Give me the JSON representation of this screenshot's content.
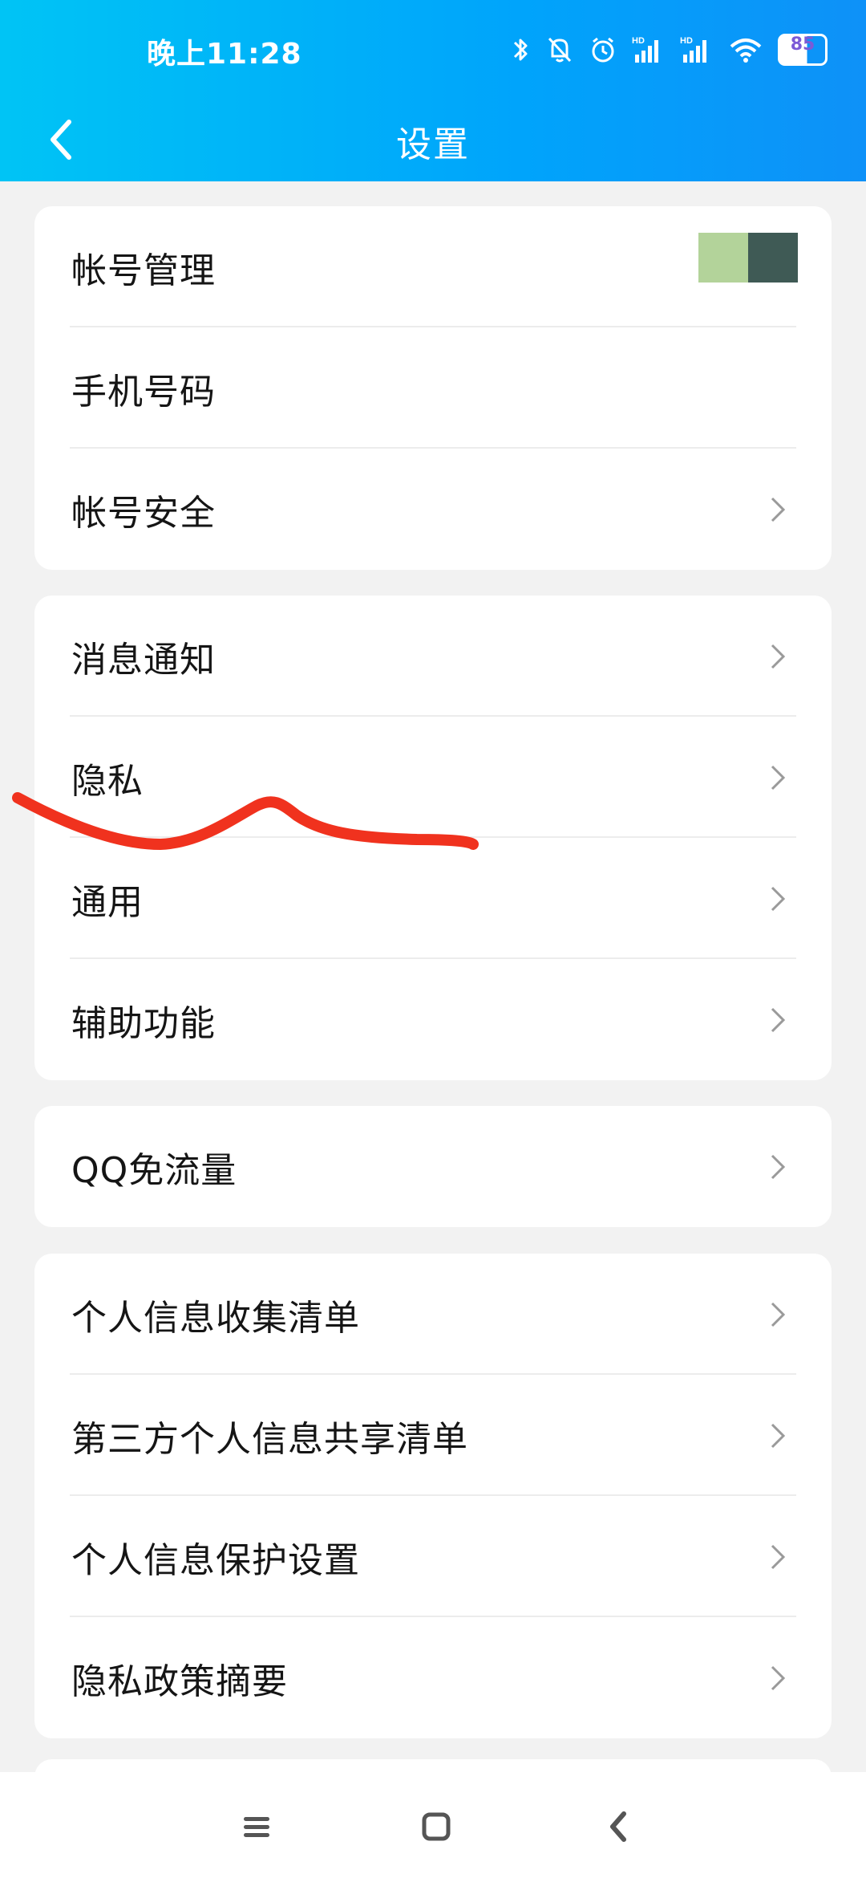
{
  "status_bar": {
    "time": "晚上11:28",
    "icons": [
      "bluetooth-icon",
      "mute-icon",
      "alarm-icon",
      "hd-signal-icon",
      "hd-signal-icon",
      "wifi-icon",
      "battery-icon"
    ],
    "battery_level": "85"
  },
  "header": {
    "title": "设置",
    "back_icon": "chevron-left-icon",
    "background_colors": [
      "#00c4f5",
      "#00a4fb",
      "#0e91f8"
    ]
  },
  "groups": [
    {
      "items": [
        {
          "label": "帐号管理",
          "trailing": "avatar"
        },
        {
          "label": "手机号码",
          "trailing": "none"
        },
        {
          "label": "帐号安全",
          "trailing": "chevron-right-icon"
        }
      ]
    },
    {
      "items": [
        {
          "label": "消息通知",
          "trailing": "chevron-right-icon"
        },
        {
          "label": "隐私",
          "trailing": "chevron-right-icon"
        },
        {
          "label": "通用",
          "trailing": "chevron-right-icon"
        },
        {
          "label": "辅助功能",
          "trailing": "chevron-right-icon"
        }
      ]
    },
    {
      "items": [
        {
          "label": "QQ免流量",
          "trailing": "chevron-right-icon"
        }
      ]
    },
    {
      "items": [
        {
          "label": "个人信息收集清单",
          "trailing": "chevron-right-icon"
        },
        {
          "label": "第三方个人信息共享清单",
          "trailing": "chevron-right-icon"
        },
        {
          "label": "个人信息保护设置",
          "trailing": "chevron-right-icon"
        },
        {
          "label": "隐私政策摘要",
          "trailing": "chevron-right-icon"
        }
      ]
    }
  ],
  "annotation": {
    "color": "#f0321e"
  },
  "avatar_colors": [
    "#b3d39a",
    "#3f5a55"
  ],
  "bottom_nav": {
    "icons": [
      "menu-icon",
      "home-icon",
      "back-icon"
    ]
  }
}
